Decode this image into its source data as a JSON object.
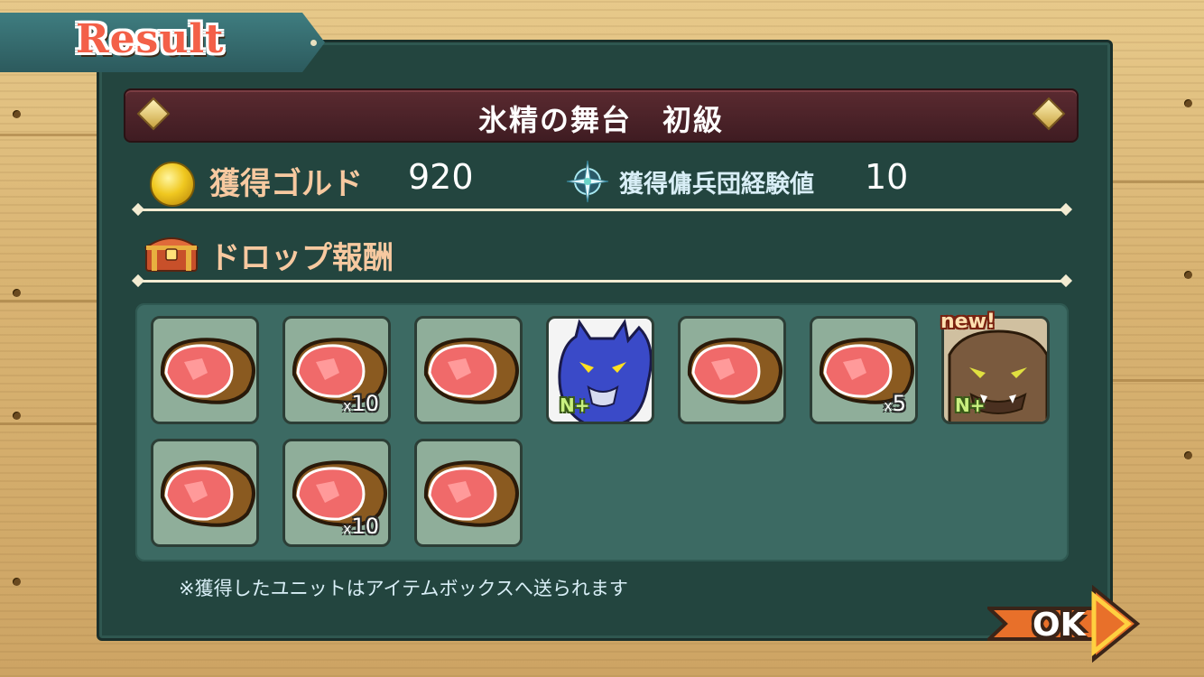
{
  "header": {
    "title": "Result"
  },
  "stage": {
    "name": "氷精の舞台　初級"
  },
  "stats": {
    "gold_label": "獲得ゴルド",
    "gold_value": "920",
    "exp_label": "獲得傭兵団経験値",
    "exp_value": "10"
  },
  "drops": {
    "label": "ドロップ報酬",
    "items": [
      {
        "icon": "meat-icon",
        "qty": ""
      },
      {
        "icon": "meat-icon",
        "qty_prefix": "x",
        "qty": "10"
      },
      {
        "icon": "meat-icon",
        "qty": ""
      },
      {
        "icon": "blue-werewolf-unit-icon",
        "rank": "N+"
      },
      {
        "icon": "meat-icon",
        "qty": ""
      },
      {
        "icon": "meat-icon",
        "qty_prefix": "x",
        "qty": "5"
      },
      {
        "icon": "brown-beast-unit-icon",
        "rank": "N+",
        "badge": "new!"
      },
      {
        "icon": "meat-icon",
        "qty": ""
      },
      {
        "icon": "meat-icon",
        "qty_prefix": "x",
        "qty": "10"
      },
      {
        "icon": "meat-icon",
        "qty": ""
      }
    ]
  },
  "note": "※獲得したユニットはアイテムボックスへ送られます",
  "ok_button": {
    "label": "OK"
  },
  "colors": {
    "board": "#23453f",
    "accent_label": "#f7c9a0",
    "stage_bar": "#4a2228",
    "ok_orange": "#e8702a"
  }
}
